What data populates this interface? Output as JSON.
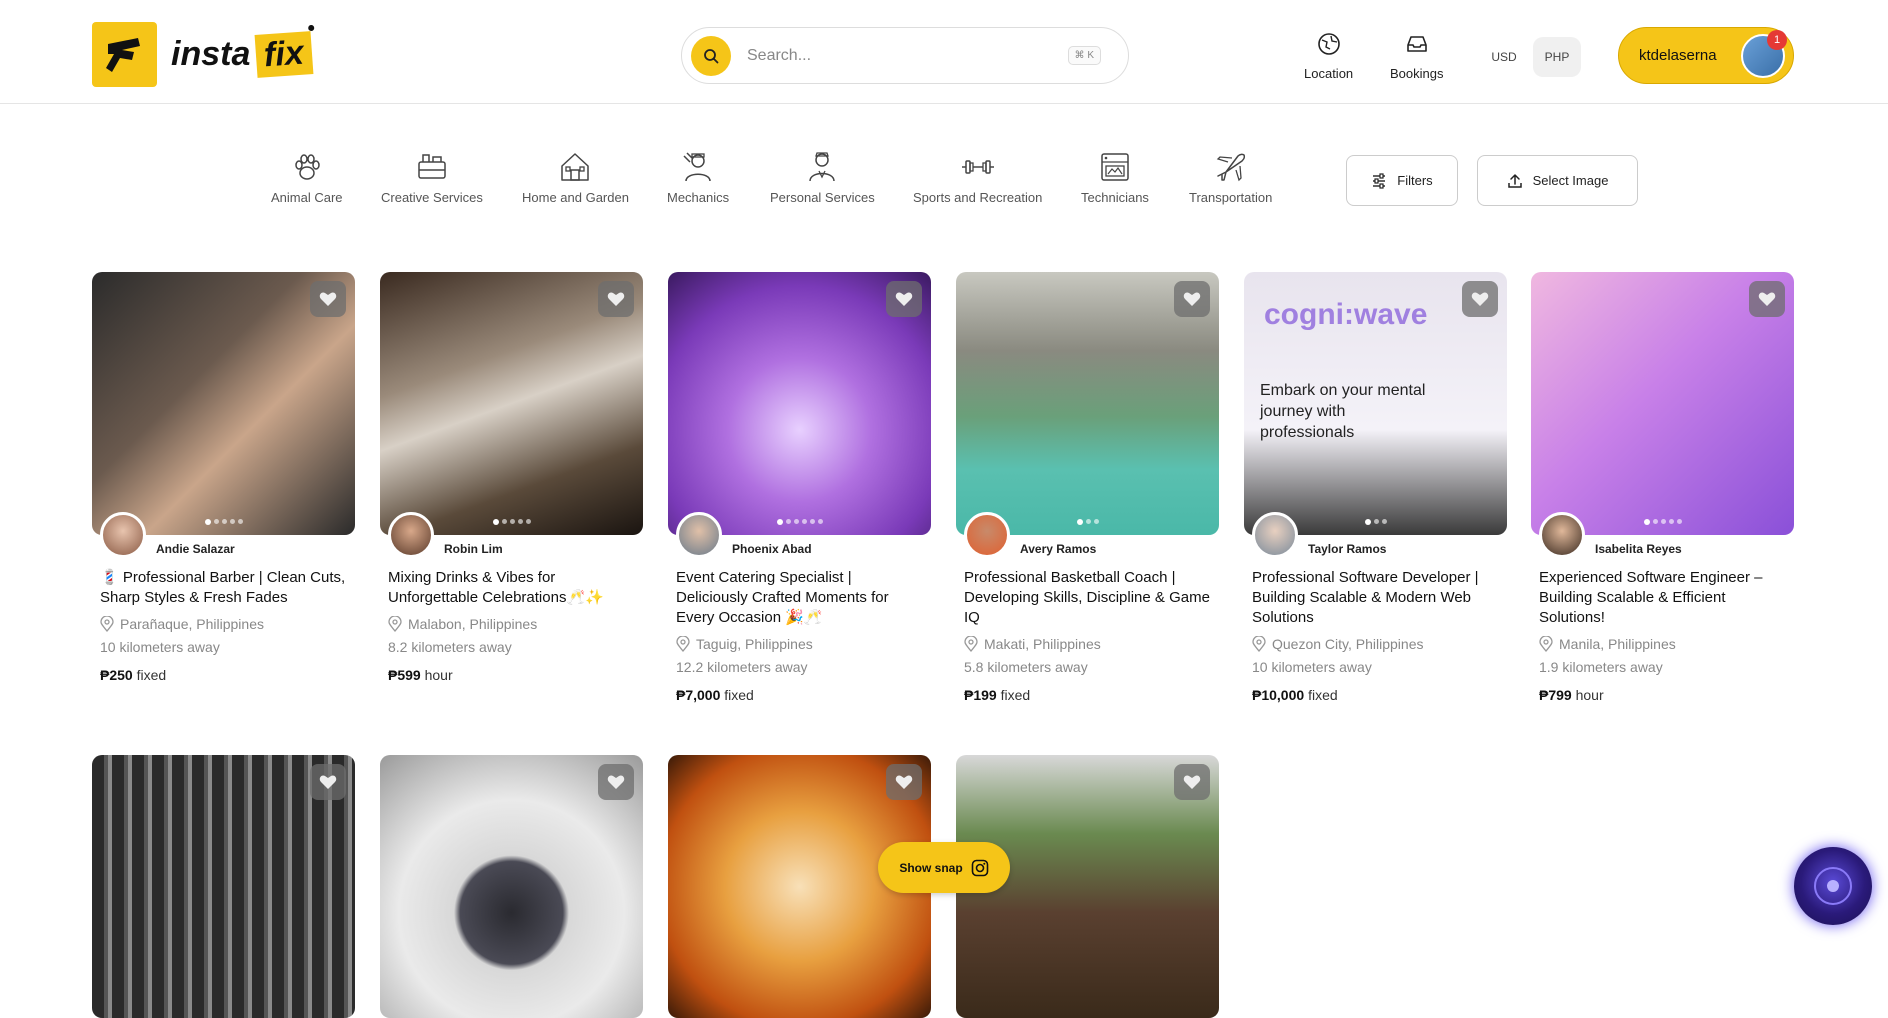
{
  "brand": {
    "logo_word1": "insta",
    "logo_word2": "fix",
    "accent": "#f5c518"
  },
  "search": {
    "placeholder": "Search...",
    "shortcut": "⌘ K"
  },
  "nav": {
    "location": "Location",
    "bookings": "Bookings"
  },
  "currency": {
    "options": [
      "USD",
      "PHP"
    ],
    "selected": "PHP"
  },
  "user": {
    "name": "ktdelaserna",
    "notifications": "1"
  },
  "categories": [
    {
      "label": "Animal Care",
      "icon": "paw-icon"
    },
    {
      "label": "Creative Services",
      "icon": "creative-icon"
    },
    {
      "label": "Home and Garden",
      "icon": "house-icon"
    },
    {
      "label": "Mechanics",
      "icon": "mechanic-icon"
    },
    {
      "label": "Personal Services",
      "icon": "person-icon"
    },
    {
      "label": "Sports and Recreation",
      "icon": "dumbbell-icon"
    },
    {
      "label": "Technicians",
      "icon": "technician-icon"
    },
    {
      "label": "Transportation",
      "icon": "plane-icon"
    }
  ],
  "actions": {
    "filters": "Filters",
    "select_image": "Select Image"
  },
  "listings": [
    {
      "seller": "Andie Salazar",
      "title": "💈 Professional Barber | Clean Cuts, Sharp Styles & Fresh Fades",
      "location": "Parañaque, Philippines",
      "distance": "10 kilometers away",
      "price": "₱250",
      "unit": "fixed"
    },
    {
      "seller": "Robin Lim",
      "title": "Mixing Drinks & Vibes for Unforgettable Celebrations🥂✨",
      "location": "Malabon, Philippines",
      "distance": "8.2 kilometers away",
      "price": "₱599",
      "unit": "hour"
    },
    {
      "seller": "Phoenix Abad",
      "title": "Event Catering Specialist | Deliciously Crafted Moments for Every Occasion 🎉🥂",
      "location": "Taguig, Philippines",
      "distance": "12.2 kilometers away",
      "price": "₱7,000",
      "unit": "fixed"
    },
    {
      "seller": "Avery Ramos",
      "title": "Professional Basketball Coach | Developing Skills, Discipline & Game IQ",
      "location": "Makati, Philippines",
      "distance": "5.8 kilometers away",
      "price": "₱199",
      "unit": "fixed"
    },
    {
      "seller": "Taylor Ramos",
      "title": "Professional Software Developer | Building Scalable & Modern Web Solutions",
      "location": "Quezon City, Philippines",
      "distance": "10 kilometers away",
      "price": "₱10,000",
      "unit": "fixed"
    },
    {
      "seller": "Isabelita Reyes",
      "title": "Experienced Software Engineer – Building Scalable & Efficient Solutions!",
      "location": "Manila, Philippines",
      "distance": "1.9 kilometers away",
      "price": "₱799",
      "unit": "hour"
    }
  ],
  "card_image_text": {
    "software_headline": "Embark on your mental journey with professionals",
    "software_brand": "cogni:wave"
  },
  "snap": {
    "label": "Show snap"
  }
}
